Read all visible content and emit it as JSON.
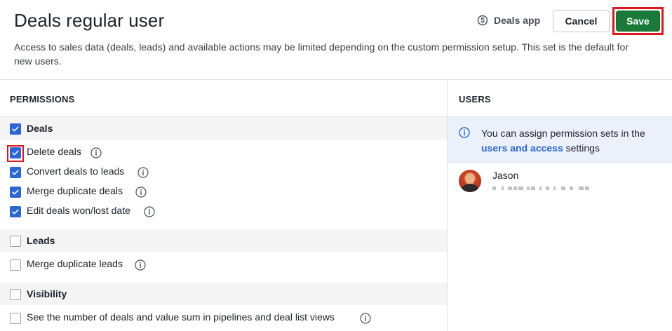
{
  "header": {
    "title": "Deals regular user",
    "description": "Access to sales data (deals, leads) and available actions may be limited depending on the custom permission setup. This set is the default for new users.",
    "app_label": "Deals app",
    "app_icon": "dollar-circle-icon",
    "cancel_label": "Cancel",
    "save_label": "Save"
  },
  "permissions": {
    "heading": "PERMISSIONS",
    "groups": [
      {
        "label": "Deals",
        "checked": true,
        "items": [
          {
            "label": "Delete deals",
            "checked": true
          },
          {
            "label": "Convert deals to leads",
            "checked": true
          },
          {
            "label": "Merge duplicate deals",
            "checked": true
          },
          {
            "label": "Edit deals won/lost date",
            "checked": true
          }
        ]
      },
      {
        "label": "Leads",
        "checked": false,
        "items": [
          {
            "label": "Merge duplicate leads",
            "checked": false
          }
        ]
      },
      {
        "label": "Visibility",
        "checked": false,
        "items": [
          {
            "label": "See the number of deals and value sum in pipelines and deal list views",
            "checked": false
          }
        ]
      }
    ]
  },
  "users": {
    "heading": "USERS",
    "notice_prefix": "You can assign permission sets in the",
    "notice_link": "users and access",
    "notice_suffix": "settings",
    "list": [
      {
        "name": "Jason"
      }
    ]
  },
  "colors": {
    "accent": "#2c66d6",
    "save": "#1a7a3a",
    "highlight": "#e0161f",
    "notice_bg": "#ebf1fb"
  }
}
